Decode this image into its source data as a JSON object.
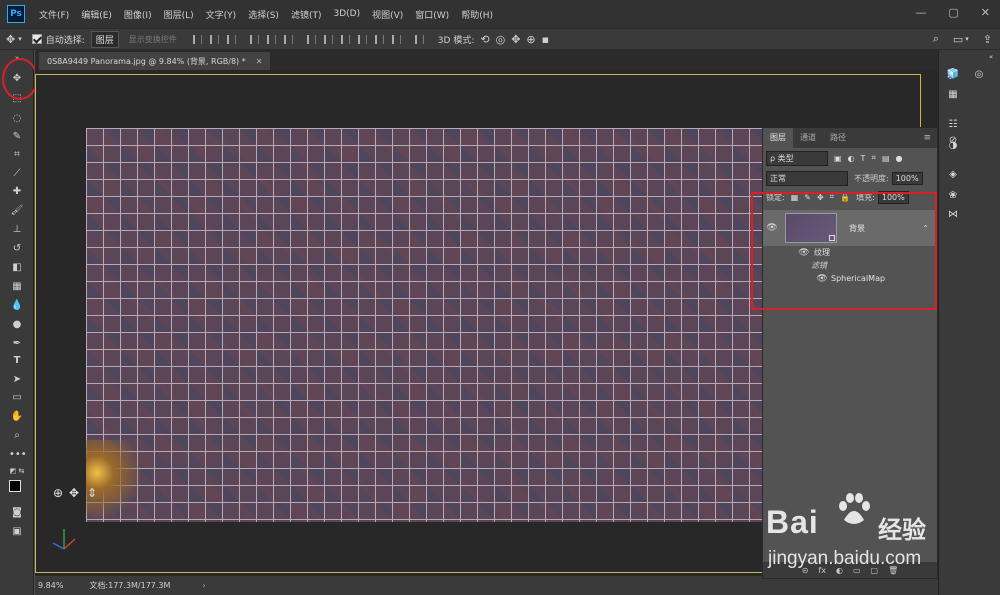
{
  "app": {
    "logo_text": "Ps"
  },
  "menu": [
    "文件(F)",
    "编辑(E)",
    "图像(I)",
    "图层(L)",
    "文字(Y)",
    "选择(S)",
    "滤镜(T)",
    "3D(D)",
    "视图(V)",
    "窗口(W)",
    "帮助(H)"
  ],
  "window_controls": [
    "—",
    "▢",
    "✕"
  ],
  "options_bar": {
    "auto_select_label": "自动选择:",
    "auto_select_target": "图层",
    "show_transform_label": "显示变换控件",
    "mode_3d_label": "3D 模式:"
  },
  "document": {
    "tab_title": "0S8A9449 Panorama.jpg @ 9.84% (背景, RGB/8) *",
    "tab_close": "✕"
  },
  "status": {
    "zoom": "9.84%",
    "doc_size": "文档:177.3M/177.3M",
    "arrow": "›"
  },
  "layers_panel": {
    "tabs": [
      "图层",
      "通道",
      "路径"
    ],
    "menu_icon": "≡",
    "filter_kind": "ρ 类型",
    "blend_mode": "正常",
    "opacity_label": "不透明度:",
    "opacity_value": "100%",
    "lock_label": "锁定:",
    "fill_label": "填充:",
    "fill_value": "100%",
    "layers": [
      {
        "name": "背景",
        "visible": true,
        "effects_label": "纹理",
        "fx_label": "滤镜",
        "filters": [
          "SphericalMap"
        ]
      }
    ],
    "bottom_icons": [
      "⊝",
      "fx",
      "◐",
      "▭",
      "▢",
      "🗑"
    ]
  },
  "watermark": {
    "logo": "Bai",
    "logo_cn": "经验",
    "url": "jingyan.baidu.com"
  },
  "colors": {
    "highlight": "#d8202a",
    "doc_border": "#c9b84d",
    "ps_blue": "#31a8ff"
  }
}
